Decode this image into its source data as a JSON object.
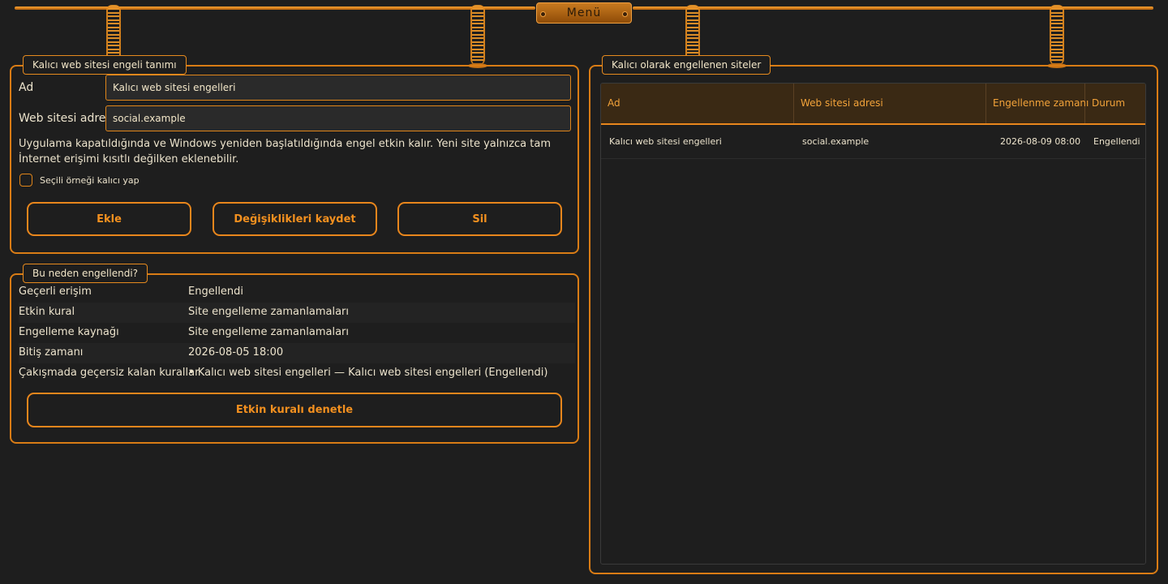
{
  "menu": {
    "label": "Menü"
  },
  "definition_panel": {
    "title": "Kalıcı web sitesi engeli tanımı",
    "name_label": "Ad",
    "name_value": "Kalıcı web sitesi engelleri",
    "url_label": "Web sitesi adresi",
    "url_value": "social.example",
    "info": "Uygulama kapatıldığında ve Windows yeniden başlatıldığında engel etkin kalır. Yeni site yalnızca tam İnternet erişimi kısıtlı değilken eklenebilir.",
    "checkbox_label": "Seçili örneği kalıcı yap",
    "checkbox_checked": false,
    "buttons": {
      "add": "Ekle",
      "save": "Değişiklikleri kaydet",
      "delete": "Sil"
    }
  },
  "reason_panel": {
    "title": "Bu neden engellendi?",
    "rows": [
      {
        "key": "Geçerli erişim",
        "value": "Engellendi"
      },
      {
        "key": "Etkin kural",
        "value": "Site engelleme zamanlamaları"
      },
      {
        "key": "Engelleme kaynağı",
        "value": "Site engelleme zamanlamaları"
      },
      {
        "key": "Bitiş zamanı",
        "value": "2026-08-05 18:00"
      },
      {
        "key": "Çakışmada geçersiz kalan kurallar",
        "value": "• Kalıcı web sitesi engelleri — Kalıcı web sitesi engelleri (Engellendi)"
      }
    ],
    "inspect_button": "Etkin kuralı denetle"
  },
  "blocked_panel": {
    "title": "Kalıcı olarak engellenen siteler",
    "columns": [
      "Ad",
      "Web sitesi adresi",
      "Engellenme zamanı",
      "Durum"
    ],
    "rows": [
      [
        "Kalıcı web sitesi engelleri",
        "social.example",
        "2026-08-09 08:00",
        "Engellendi"
      ]
    ]
  },
  "colors": {
    "accent": "#e8861c",
    "background": "#1e1e1e",
    "header_bg": "#3a2914",
    "text": "#ece3cc"
  }
}
